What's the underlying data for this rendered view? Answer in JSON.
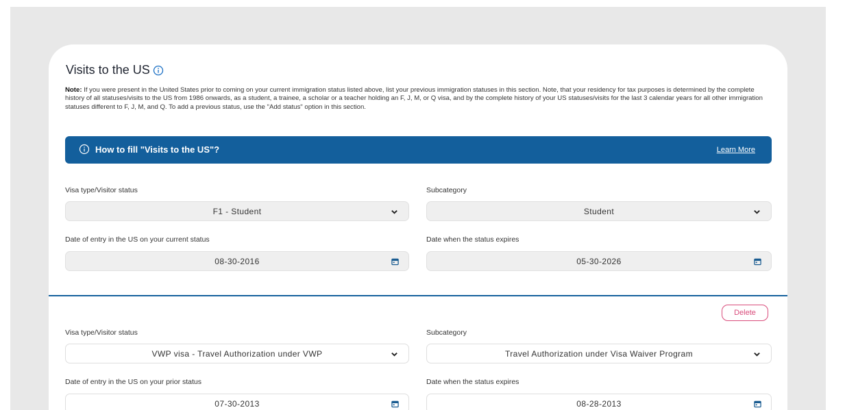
{
  "section": {
    "title": "Visits to the US",
    "note_label": "Note:",
    "note_text": "If you were present in the United States prior to coming on your current immigration status listed above, list your previous immigration statuses in this section. Note, that your residency for tax purposes is determined by the complete history of all statuses/visits to the US from 1986 onwards, as a student, a trainee, a scholar or a teacher holding an F, J, M, or Q visa, and by the complete history of your US statuses/visits for the last 3 calendar years for all other immigration statuses different to F, J, M, and Q. To add a previous status, use the \"Add status\" option in this section."
  },
  "banner": {
    "title": "How to fill \"Visits to the US\"?",
    "link": "Learn More",
    "color": "#135f9c"
  },
  "entries": [
    {
      "visa_label": "Visa type/Visitor status",
      "visa_value": "F1 - Student",
      "subcategory_label": "Subcategory",
      "subcategory_value": "Student",
      "entry_label": "Date of entry in the US on your current status",
      "entry_value": "08-30-2016",
      "expires_label": "Date when the status expires",
      "expires_value": "05-30-2026"
    },
    {
      "delete_label": "Delete",
      "visa_label": "Visa type/Visitor status",
      "visa_value": "VWP visa - Travel Authorization under VWP",
      "subcategory_label": "Subcategory",
      "subcategory_value": "Travel Authorization under Visa Waiver Program",
      "entry_label": "Date of entry in the US on your prior status",
      "entry_value": "07-30-2013",
      "expires_label": "Date when the status expires",
      "expires_value": "08-28-2013"
    }
  ],
  "icons": {
    "info": "info-icon",
    "chevron": "chevron-down-icon",
    "calendar": "calendar-icon"
  },
  "colors": {
    "accent": "#135f9c",
    "delete": "#d94a7a"
  }
}
